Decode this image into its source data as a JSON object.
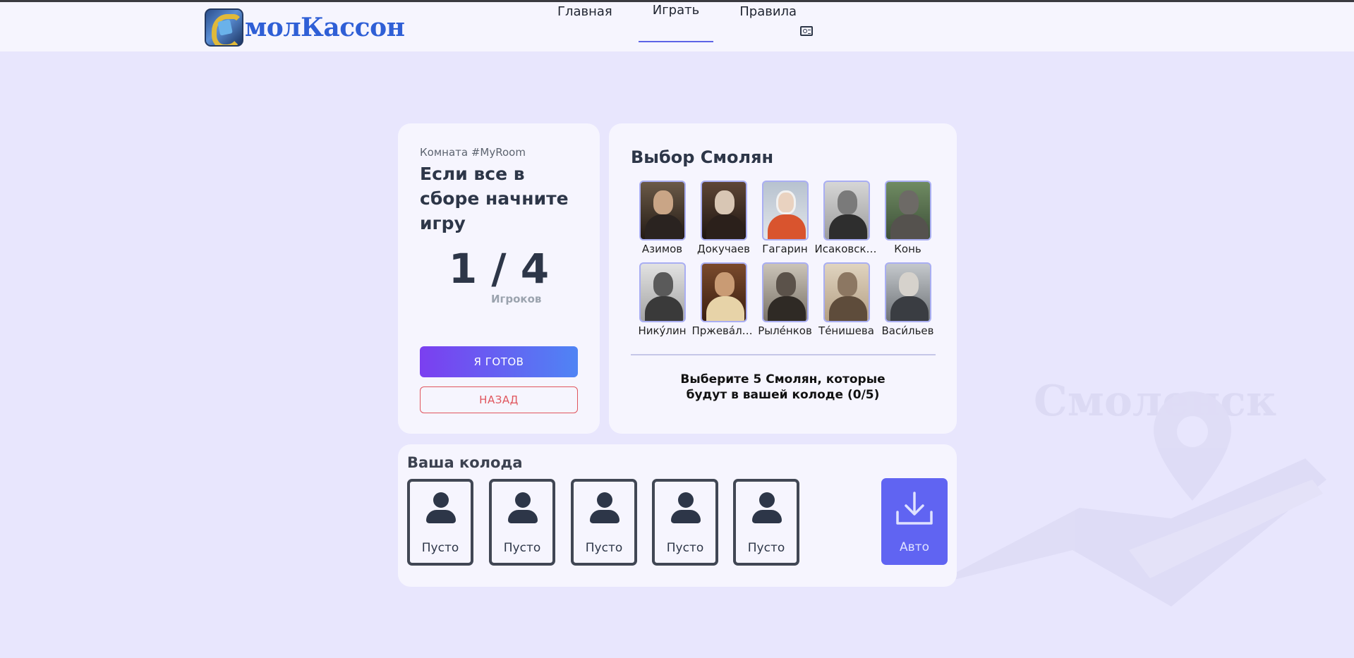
{
  "header": {
    "logo_text": "молКассон",
    "nav": [
      {
        "label": "Главная"
      },
      {
        "label": "Играть",
        "active": true
      },
      {
        "label": "Правила",
        "icon": "rules-card-icon"
      }
    ]
  },
  "watermark": {
    "text": "Смоленск",
    "icon": "map-pin-icon"
  },
  "room": {
    "label": "Комната #MyRoom",
    "title": "Если все в сборе начните игру",
    "counter": "1 / 4",
    "counter_label": "Игроков",
    "ready_button": "Я ГОТОВ",
    "back_button": "НАЗАД"
  },
  "selection": {
    "title": "Выбор Смолян",
    "people": [
      {
        "name": "Азимов"
      },
      {
        "name": "Докучаев"
      },
      {
        "name": "Гагарин"
      },
      {
        "name": "Исаковский"
      },
      {
        "name": "Конь"
      },
      {
        "name": "Нику́лин"
      },
      {
        "name": "Пржева́льский"
      },
      {
        "name": "Рыле́нков"
      },
      {
        "name": "Те́нишева"
      },
      {
        "name": "Васи́льев"
      }
    ],
    "hint_line1": "Выберите 5 Смолян, которые",
    "hint_line2": "будут в вашей колоде (0/5)"
  },
  "deck": {
    "title": "Ваша колода",
    "slots": [
      {
        "label": "Пусто"
      },
      {
        "label": "Пусто"
      },
      {
        "label": "Пусто"
      },
      {
        "label": "Пусто"
      },
      {
        "label": "Пусто"
      }
    ],
    "auto_button": "Авто",
    "auto_icon": "download-icon"
  },
  "colors": {
    "background": "#e8e6fd",
    "card": "#f6f5fe",
    "accent": "#6064f2",
    "danger": "#e0555d",
    "text": "#2d3648"
  }
}
